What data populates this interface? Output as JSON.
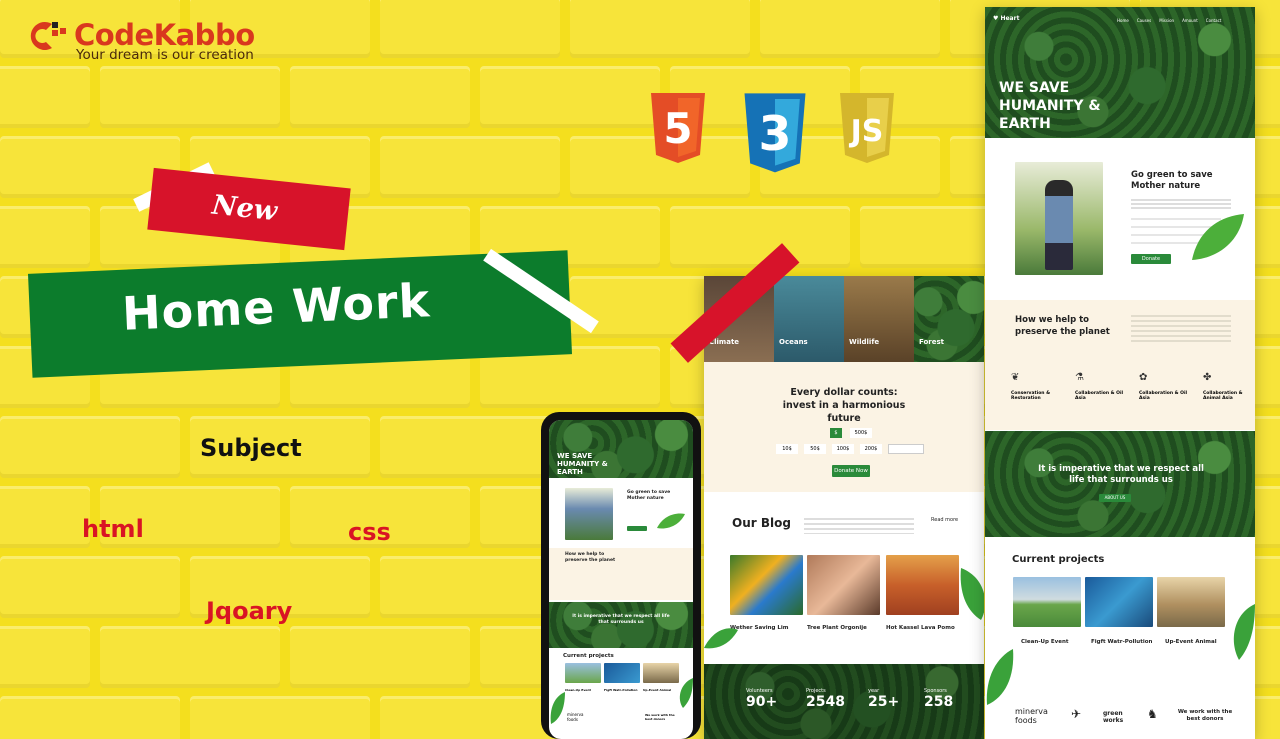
{
  "brand": {
    "name_part1": "Code",
    "name_part2": "Kabbo",
    "tagline": "Your dream is our creation"
  },
  "banners": {
    "new": "New",
    "title": "Home Work"
  },
  "subject": {
    "heading": "Subject",
    "items": [
      "html",
      "css",
      "Jqoary"
    ]
  },
  "tech_icons": [
    "html5-icon",
    "css3-icon",
    "js-icon"
  ],
  "colors": {
    "wall": "#f4df1e",
    "red": "#d7132a",
    "green": "#0c7c2c",
    "site_green": "#2a8a3a",
    "cream": "#fbf3e4"
  },
  "site": {
    "brand": "Heart",
    "nav": [
      "Home",
      "Causes",
      "Mission",
      "Amount",
      "Contact"
    ],
    "hero": "WE SAVE HUMANITY & EARTH",
    "green_title": "Go green to save Mother nature",
    "green_button": "Donate",
    "help_title": "How we help to preserve the planet",
    "help_items": [
      "Conservation & Restoration",
      "Collaboration & Oil Asia",
      "Collaboration & Oil Asia",
      "Collaboration & Animal Asia"
    ],
    "imperative": "It is imperative that we respect all life that surrounds us",
    "imperative_button": "ABOUT US",
    "projects_title": "Current projects",
    "projects": [
      "Clean-Up Event",
      "Figft Watr-Pollution",
      "Up-Event Animal"
    ],
    "partners": [
      "minerva foods",
      "green works",
      "We work with the best donors"
    ]
  },
  "site2": {
    "categories": [
      "Climate",
      "Oceans",
      "Wildlife",
      "Forest"
    ],
    "invest_title": "Every dollar counts: invest in a harmonious future",
    "amounts_row1": [
      "$",
      "500$"
    ],
    "amounts_row2": [
      "10$",
      "50$",
      "100$",
      "200$"
    ],
    "donate_button": "Donate Now",
    "blog_title": "Our Blog",
    "read_more": "Read more",
    "posts": [
      "Wether Saving Lim",
      "Tree Plant Orgonije",
      "Hot Kassel Lava Pomo"
    ],
    "stats": [
      {
        "label": "Volunteers",
        "value": "90+"
      },
      {
        "label": "Projects",
        "value": "2548"
      },
      {
        "label": "year",
        "value": "25+"
      },
      {
        "label": "Sponsors",
        "value": "258"
      }
    ]
  }
}
